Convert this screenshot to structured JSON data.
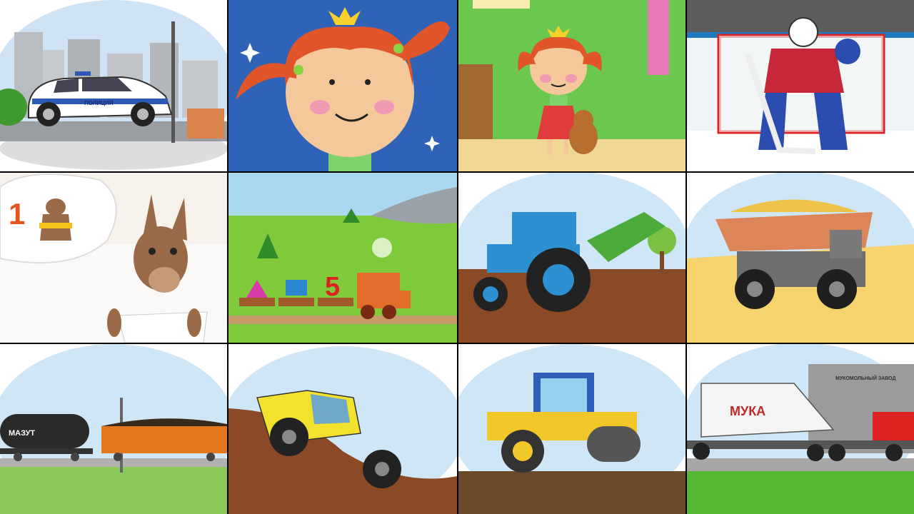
{
  "tiles": [
    {
      "id": "police-car",
      "text": "ПОЛИЦИЯ"
    },
    {
      "id": "girl-portrait"
    },
    {
      "id": "girl-with-teddy"
    },
    {
      "id": "hockey-goalie"
    },
    {
      "id": "kangaroo",
      "text": "1"
    },
    {
      "id": "toy-train",
      "text": "5"
    },
    {
      "id": "blue-tractor"
    },
    {
      "id": "dump-truck"
    },
    {
      "id": "freight-train",
      "text": "МАЗУТ"
    },
    {
      "id": "yellow-suv"
    },
    {
      "id": "road-roller"
    },
    {
      "id": "flour-truck",
      "text": "МУКА",
      "sign": "МУКОМОЛЬНЫЙ ЗАВОД"
    }
  ],
  "colors": {
    "separator": "#000000",
    "sky": "#cfe6f6",
    "grass": "#55b832"
  }
}
